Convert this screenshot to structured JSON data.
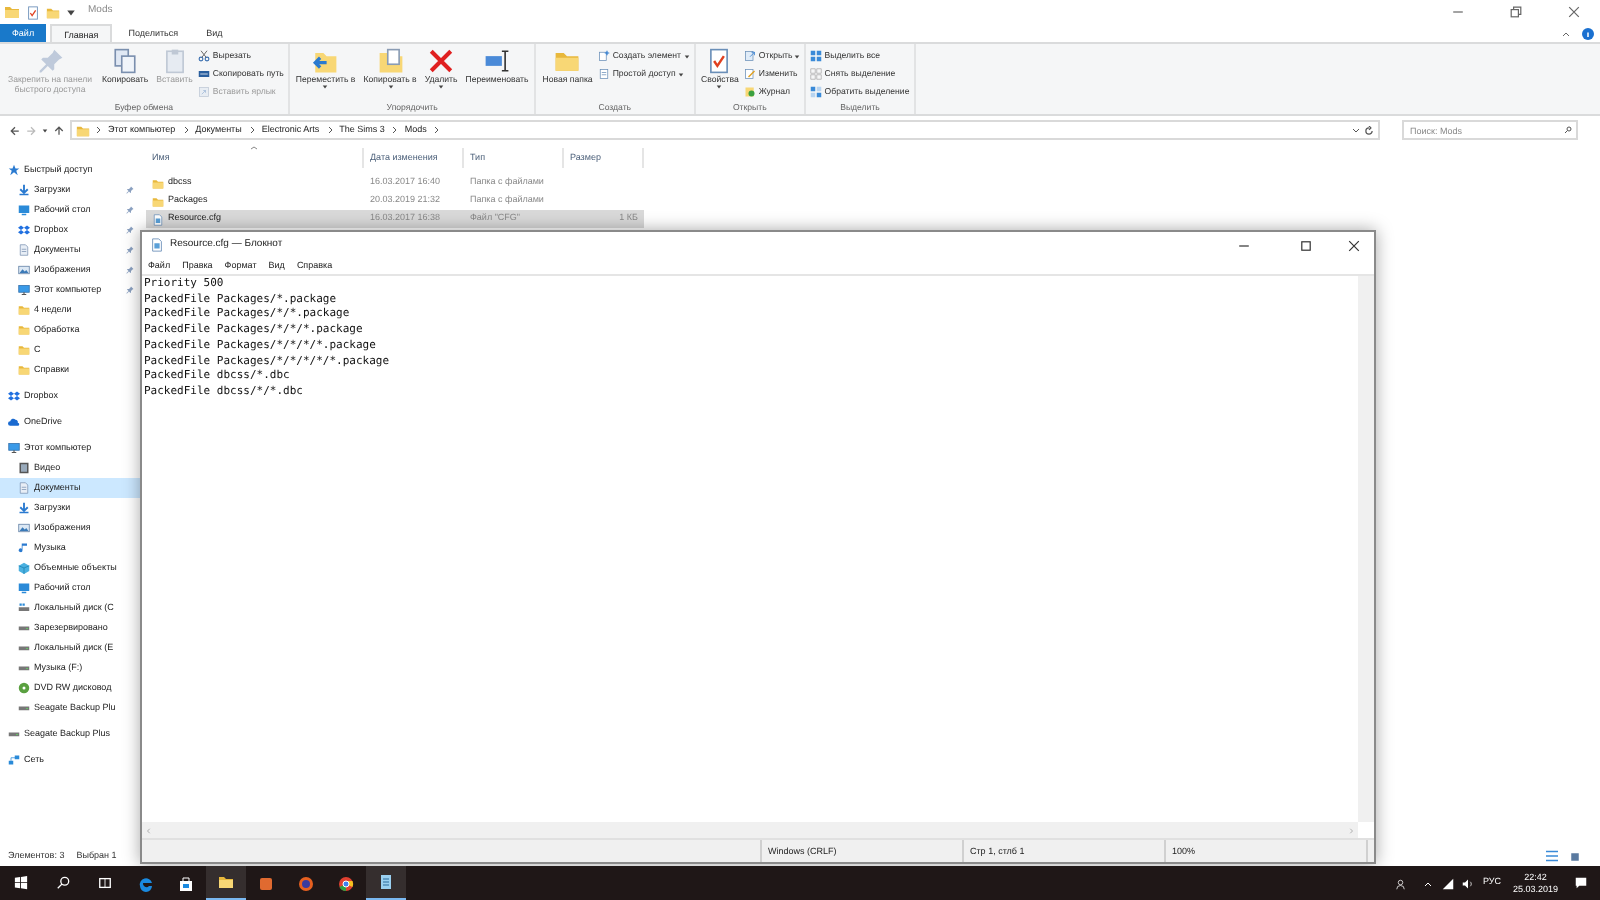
{
  "explorer": {
    "title": "Mods",
    "tabs": [
      {
        "label": "Файл",
        "kind": "file",
        "selected": false
      },
      {
        "label": "Главная",
        "kind": "tab",
        "selected": true
      },
      {
        "label": "Поделиться",
        "kind": "tab",
        "selected": false
      },
      {
        "label": "Вид",
        "kind": "tab",
        "selected": false
      }
    ],
    "ribbon": [
      {
        "label": "Буфер обмена",
        "items": [
          {
            "kind": "large",
            "label": "Закрепить на панели быстрого доступа",
            "disabled": true,
            "dropdown": false
          },
          {
            "kind": "large",
            "label": "Копировать",
            "disabled": false,
            "dropdown": false
          },
          {
            "kind": "large",
            "label": "Вставить",
            "disabled": true,
            "dropdown": false
          },
          {
            "kind": "small",
            "label": "Вырезать",
            "disabled": false,
            "dropdown": false
          },
          {
            "kind": "small",
            "label": "Скопировать путь",
            "disabled": false,
            "dropdown": false
          },
          {
            "kind": "small",
            "label": "Вставить ярлык",
            "disabled": true,
            "dropdown": false
          }
        ]
      },
      {
        "label": "Упорядочить",
        "items": [
          {
            "kind": "large",
            "label": "Переместить в",
            "disabled": false,
            "dropdown": true
          },
          {
            "kind": "large",
            "label": "Копировать в",
            "disabled": false,
            "dropdown": true
          },
          {
            "kind": "large",
            "label": "Удалить",
            "disabled": false,
            "dropdown": true
          },
          {
            "kind": "large",
            "label": "Переименовать",
            "disabled": false,
            "dropdown": false
          }
        ]
      },
      {
        "label": "Создать",
        "items": [
          {
            "kind": "large",
            "label": "Новая папка",
            "disabled": false,
            "dropdown": false
          },
          {
            "kind": "small",
            "label": "Создать элемент",
            "disabled": false,
            "dropdown": true
          },
          {
            "kind": "small",
            "label": "Простой доступ",
            "disabled": false,
            "dropdown": true
          }
        ]
      },
      {
        "label": "Открыть",
        "items": [
          {
            "kind": "large",
            "label": "Свойства",
            "disabled": false,
            "dropdown": true
          },
          {
            "kind": "small",
            "label": "Открыть",
            "disabled": false,
            "dropdown": true
          },
          {
            "kind": "small",
            "label": "Изменить",
            "disabled": false,
            "dropdown": false
          },
          {
            "kind": "small",
            "label": "Журнал",
            "disabled": false,
            "dropdown": false
          }
        ]
      },
      {
        "label": "Выделить",
        "items": [
          {
            "kind": "small",
            "label": "Выделить все",
            "disabled": false,
            "dropdown": false
          },
          {
            "kind": "small",
            "label": "Снять выделение",
            "disabled": false,
            "dropdown": false
          },
          {
            "kind": "small",
            "label": "Обратить выделение",
            "disabled": false,
            "dropdown": false
          }
        ]
      }
    ],
    "breadcrumbs": [
      "Этот компьютер",
      "Документы",
      "Electronic Arts",
      "The Sims 3",
      "Mods"
    ],
    "search": {
      "placeholder": "Поиск: Mods"
    },
    "nav": [
      {
        "label": "Быстрый доступ",
        "selected": false,
        "children": [
          {
            "label": "Загрузки",
            "selected": false,
            "pinned": true
          },
          {
            "label": "Рабочий стол",
            "selected": false,
            "pinned": true
          },
          {
            "label": "Dropbox",
            "selected": false,
            "pinned": true
          },
          {
            "label": "Документы",
            "selected": false,
            "pinned": true
          },
          {
            "label": "Изображения",
            "selected": false,
            "pinned": true
          },
          {
            "label": "Этот компьютер",
            "selected": false,
            "pinned": true
          },
          {
            "label": "4 недели",
            "selected": false,
            "pinned": false
          },
          {
            "label": "Обработка",
            "selected": false,
            "pinned": false
          },
          {
            "label": "С",
            "selected": false,
            "pinned": false
          },
          {
            "label": "Справки",
            "selected": false,
            "pinned": false
          }
        ]
      },
      {
        "label": "Dropbox",
        "selected": false
      },
      {
        "label": "OneDrive",
        "selected": false
      },
      {
        "label": "Этот компьютер",
        "selected": false,
        "children": [
          {
            "label": "Видео",
            "selected": false
          },
          {
            "label": "Документы",
            "selected": true
          },
          {
            "label": "Загрузки",
            "selected": false
          },
          {
            "label": "Изображения",
            "selected": false
          },
          {
            "label": "Музыка",
            "selected": false
          },
          {
            "label": "Объемные объекты",
            "selected": false
          },
          {
            "label": "Рабочий стол",
            "selected": false
          },
          {
            "label": "Локальный диск (C",
            "selected": false
          },
          {
            "label": "Зарезервировано",
            "selected": false
          },
          {
            "label": "Локальный диск (E",
            "selected": false
          },
          {
            "label": "Музыка (F:)",
            "selected": false
          },
          {
            "label": "DVD RW дисковод",
            "selected": false
          },
          {
            "label": "Seagate Backup Plu",
            "selected": false
          }
        ]
      },
      {
        "label": "Seagate Backup Plus",
        "selected": false
      },
      {
        "label": "Сеть",
        "selected": false
      }
    ],
    "columns": [
      "Имя",
      "Дата изменения",
      "Тип",
      "Размер"
    ],
    "files": [
      {
        "kind": "folder",
        "name": "dbcss",
        "date": "16.03.2017 16:40",
        "type": "Папка с файлами",
        "selected": false
      },
      {
        "kind": "folder",
        "name": "Packages",
        "date": "20.03.2019 21:32",
        "type": "Папка с файлами",
        "selected": false
      },
      {
        "kind": "file",
        "name": "Resource.cfg",
        "date": "16.03.2017 16:38",
        "type": "Файл \"CFG\"",
        "size": "1 КБ",
        "selected": true
      }
    ],
    "status_bar": [
      "Элементов: 3",
      "Выбран 1"
    ]
  },
  "notepad": {
    "title": "Resource.cfg — Блокнот",
    "menu": [
      "Файл",
      "Правка",
      "Формат",
      "Вид",
      "Справка"
    ],
    "lines": [
      "Priority 500",
      "PackedFile Packages/*.package",
      "PackedFile Packages/*/*.package",
      "PackedFile Packages/*/*/*.package",
      "PackedFile Packages/*/*/*/*.package",
      "PackedFile Packages/*/*/*/*/*.package",
      "PackedFile dbcss/*.dbc",
      "PackedFile dbcss/*/*.dbc"
    ],
    "status_bar": [
      "Windows (CRLF)",
      "Стр 1, стлб 1",
      "100%"
    ]
  },
  "taskbar": {
    "apps": [
      {
        "kind": "edge",
        "running": false
      },
      {
        "kind": "store",
        "running": false
      },
      {
        "kind": "explorer",
        "running": true
      },
      {
        "kind": "app",
        "running": false
      },
      {
        "kind": "firefox",
        "running": false
      },
      {
        "kind": "chrome",
        "running": false
      },
      {
        "kind": "notepad",
        "running": true
      }
    ],
    "language": "РУС",
    "time": "22:42",
    "date": "25.03.2019"
  }
}
